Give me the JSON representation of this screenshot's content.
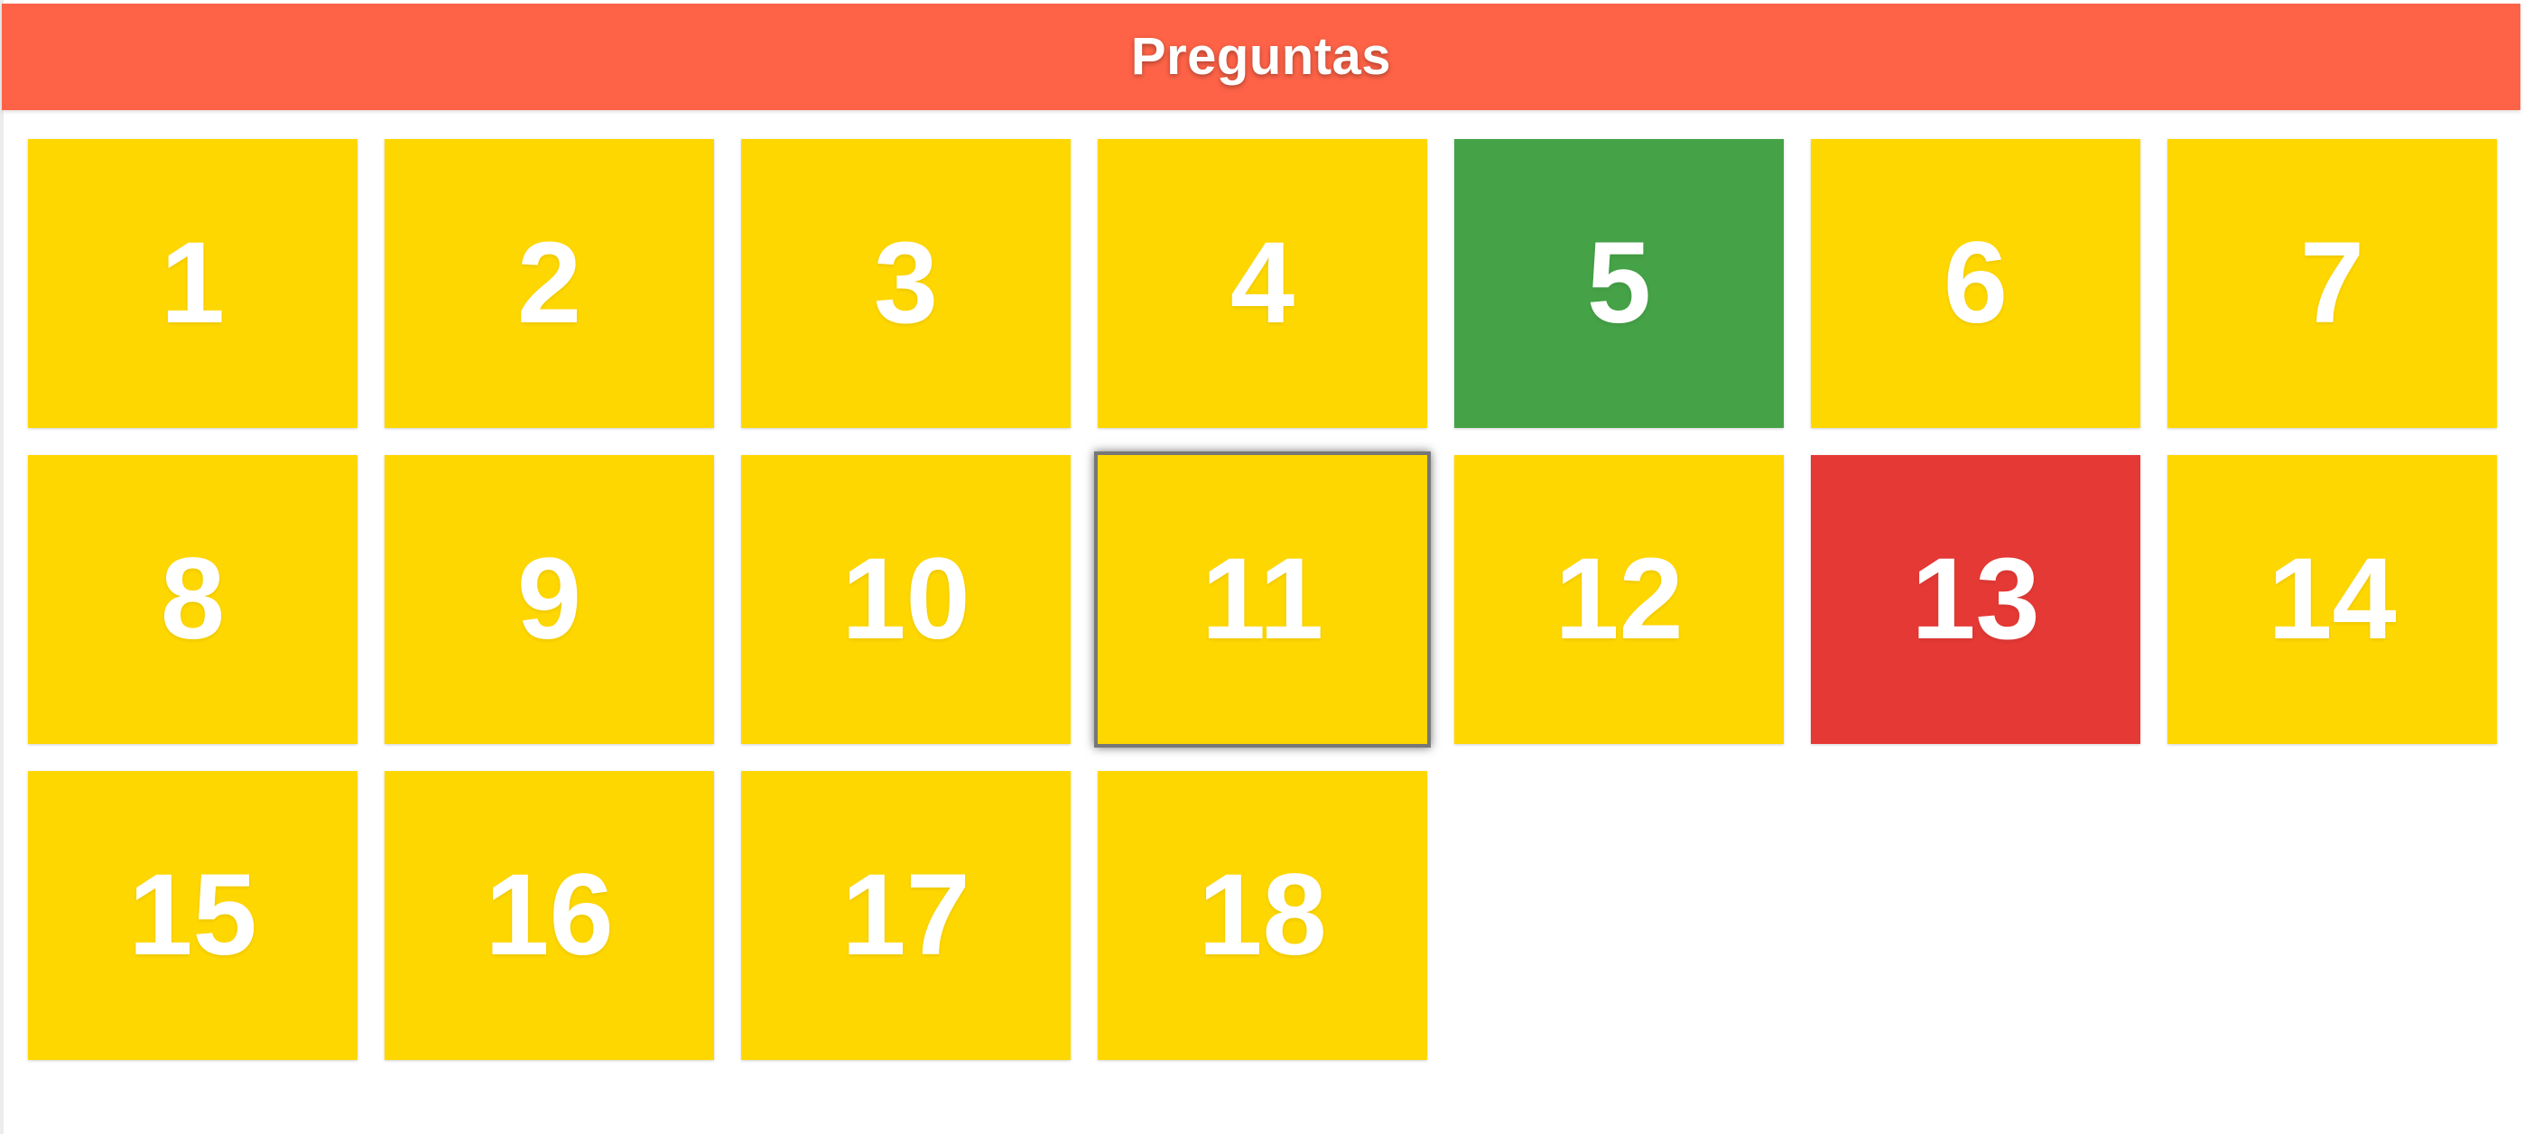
{
  "header": {
    "title": "Preguntas"
  },
  "colors": {
    "header_bg": "#ff6347",
    "pending": "#ffd700",
    "correct": "#45a247",
    "incorrect": "#e53935",
    "text": "#ffffff"
  },
  "questions": [
    {
      "label": "1",
      "status": "pending"
    },
    {
      "label": "2",
      "status": "pending"
    },
    {
      "label": "3",
      "status": "pending"
    },
    {
      "label": "4",
      "status": "pending"
    },
    {
      "label": "5",
      "status": "correct"
    },
    {
      "label": "6",
      "status": "pending"
    },
    {
      "label": "7",
      "status": "pending"
    },
    {
      "label": "8",
      "status": "pending"
    },
    {
      "label": "9",
      "status": "pending"
    },
    {
      "label": "10",
      "status": "pending"
    },
    {
      "label": "11",
      "status": "pending",
      "selected": true
    },
    {
      "label": "12",
      "status": "pending"
    },
    {
      "label": "13",
      "status": "incorrect"
    },
    {
      "label": "14",
      "status": "pending"
    },
    {
      "label": "15",
      "status": "pending"
    },
    {
      "label": "16",
      "status": "pending"
    },
    {
      "label": "17",
      "status": "pending"
    },
    {
      "label": "18",
      "status": "pending"
    }
  ]
}
